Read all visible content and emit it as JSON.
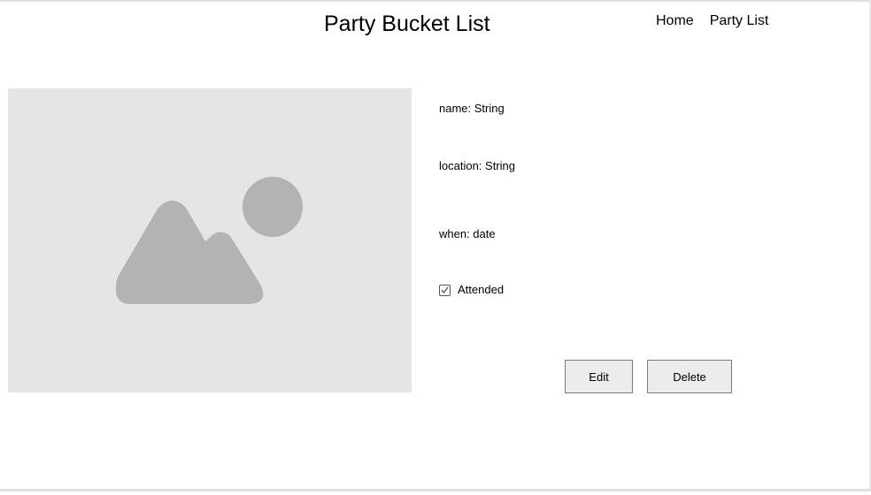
{
  "header": {
    "title": "Party Bucket List",
    "nav": [
      {
        "label": "Home"
      },
      {
        "label": "Party List"
      }
    ]
  },
  "image": {
    "icon": "image-placeholder-icon",
    "background_color": "#e5e5e5",
    "icon_color": "#b3b3b3"
  },
  "details": {
    "name": "name: String",
    "location": "location: String",
    "when": "when: date",
    "attended": {
      "label": "Attended",
      "checked": true
    }
  },
  "actions": {
    "edit_label": "Edit",
    "delete_label": "Delete"
  }
}
